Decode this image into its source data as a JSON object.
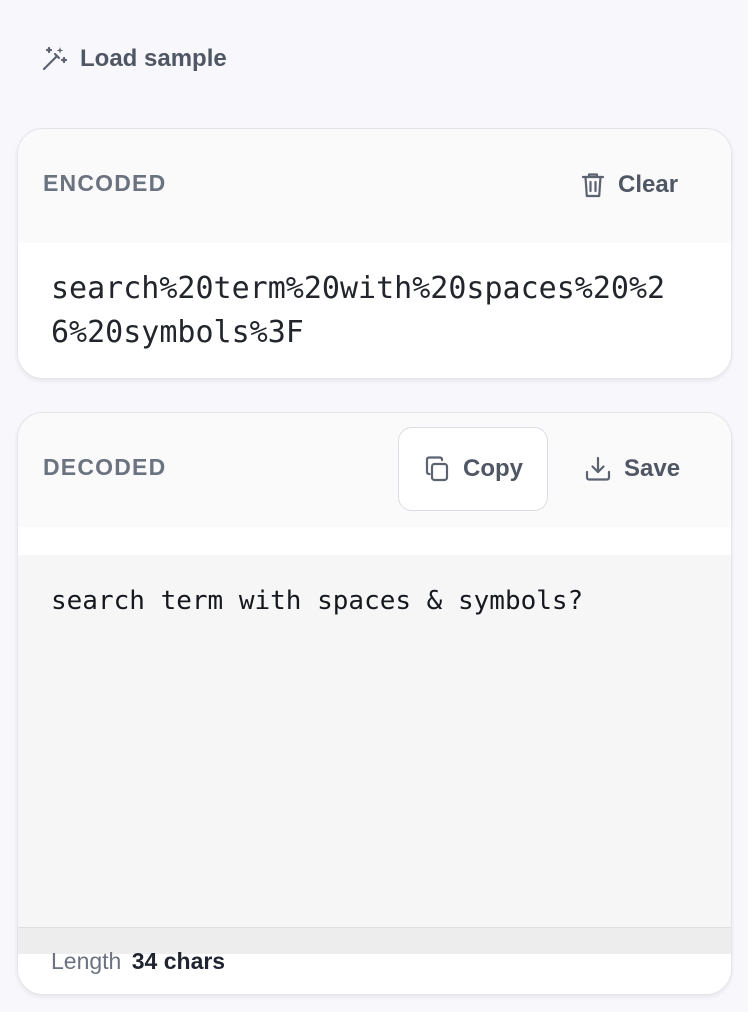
{
  "toolbar": {
    "load_sample_label": "Load sample",
    "load_sample_icon": "magic-wand-icon"
  },
  "encoded": {
    "title": "ENCODED",
    "clear_label": "Clear",
    "clear_icon": "trash-icon",
    "value": "search%20term%20with%20spaces%20%26%20symbols%3F"
  },
  "decoded": {
    "title": "DECODED",
    "copy_label": "Copy",
    "copy_icon": "copy-icon",
    "save_label": "Save",
    "save_icon": "download-icon",
    "value": "search term with spaces & symbols?",
    "length_label": "Length",
    "length_value": "34 chars"
  },
  "colors": {
    "page_background": "#f8f8fc",
    "card_header": "#fafafa",
    "decoded_area": "#f6f6f6",
    "muted_text": "#6b7280",
    "button_text": "#4f5664"
  }
}
